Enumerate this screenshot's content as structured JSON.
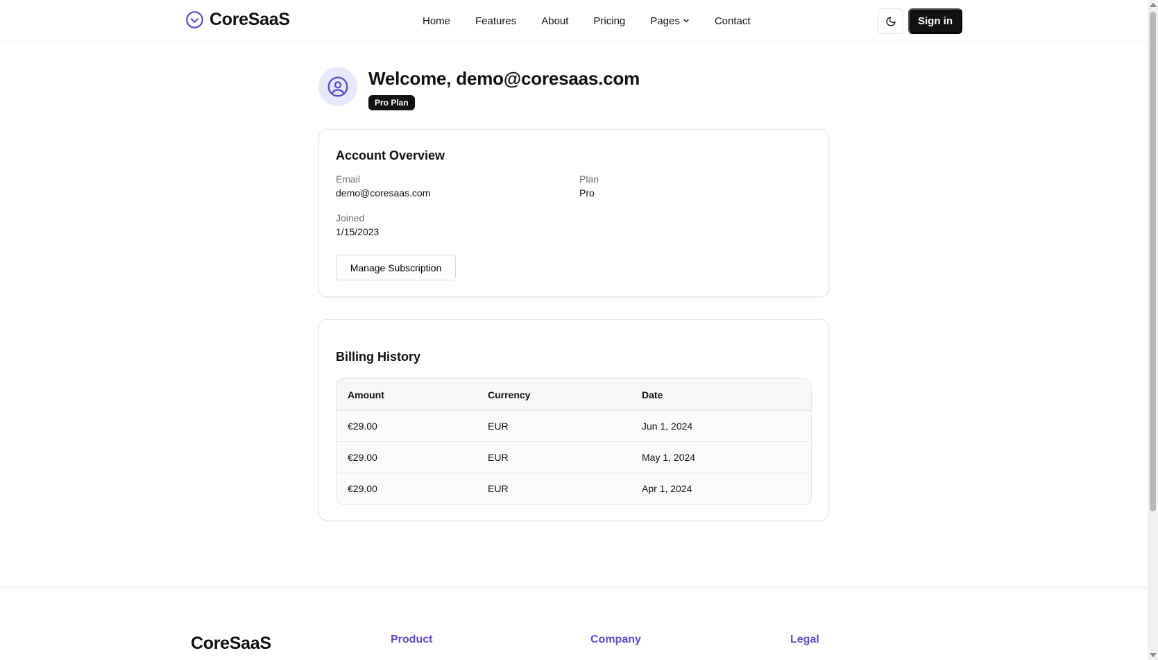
{
  "brand": {
    "name": "CoreSaaS",
    "accent": "#5b4cdb",
    "icon": "check-circle-icon"
  },
  "nav": {
    "links": [
      "Home",
      "Features",
      "About",
      "Pricing",
      "Pages",
      "Contact"
    ],
    "theme_icon": "moon-icon",
    "signin_label": "Sign in"
  },
  "welcome": {
    "title": "Welcome, demo@coresaas.com",
    "plan_badge": "Pro Plan",
    "avatar_icon": "user-circle-icon"
  },
  "overview": {
    "title": "Account Overview",
    "email_label": "Email",
    "email_value": "demo@coresaas.com",
    "plan_label": "Plan",
    "plan_value": "Pro",
    "joined_label": "Joined",
    "joined_value": "1/15/2023",
    "manage_label": "Manage Subscription"
  },
  "billing": {
    "title": "Billing History",
    "headers": [
      "Amount",
      "Currency",
      "Date"
    ],
    "rows": [
      {
        "amount": "€29.00",
        "currency": "EUR",
        "date": "Jun 1, 2024"
      },
      {
        "amount": "€29.00",
        "currency": "EUR",
        "date": "May 1, 2024"
      },
      {
        "amount": "€29.00",
        "currency": "EUR",
        "date": "Apr 1, 2024"
      }
    ]
  },
  "footer": {
    "brand": "CoreSaaS",
    "columns": [
      "Product",
      "Company",
      "Legal"
    ]
  }
}
